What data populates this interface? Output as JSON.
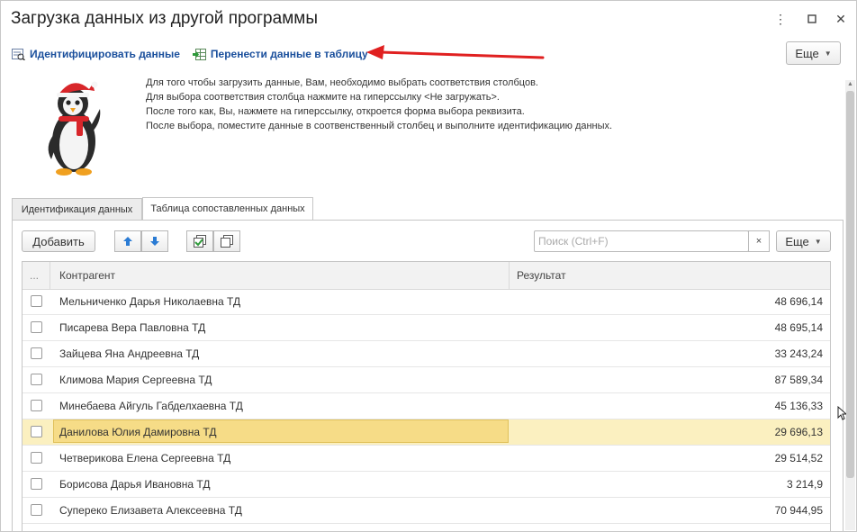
{
  "window": {
    "title": "Загрузка данных из другой программы",
    "more_label": "Еще"
  },
  "commands": {
    "identify_label": "Идентифицировать данные",
    "transfer_label": "Перенести данные в таблицу"
  },
  "help_lines": [
    "Для того чтобы загрузить данные, Вам, необходимо выбрать соответствия столбцов.",
    "Для выбора соответствия столбца нажмите на гиперссылку <Не загружать>.",
    "После того как, Вы, нажмете на гиперссылку, откроется форма выбора реквизита.",
    "После выбора, поместите данные в соотвенственный столбец и выполните идентификацию данных."
  ],
  "tabs": [
    {
      "label": "Идентификация данных",
      "active": false
    },
    {
      "label": "Таблица сопоставленных данных",
      "active": true
    }
  ],
  "toolbar": {
    "add_label": "Добавить",
    "search_placeholder": "Поиск (Ctrl+F)",
    "clear_label": "×",
    "more_label": "Еще"
  },
  "table": {
    "columns": [
      "...",
      "Контрагент",
      "Результат"
    ],
    "rows": [
      {
        "name": "Мельниченко Дарья Николаевна ТД",
        "result": "48 696,14",
        "checked": false
      },
      {
        "name": "Писарева Вера Павловна ТД",
        "result": "48 695,14",
        "checked": false
      },
      {
        "name": "Зайцева Яна Андреевна ТД",
        "result": "33 243,24",
        "checked": false
      },
      {
        "name": "Климова Мария Сергеевна ТД",
        "result": "87 589,34",
        "checked": false
      },
      {
        "name": "Минебаева Айгуль Габделхаевна ТД",
        "result": "45 136,33",
        "checked": false
      },
      {
        "name": "Данилова Юлия Дамировна ТД",
        "result": "29 696,13",
        "checked": false,
        "selected": true
      },
      {
        "name": "Четверикова Елена Сергеевна ТД",
        "result": "29 514,52",
        "checked": false
      },
      {
        "name": "Борисова Дарья Ивановна ТД",
        "result": "3 214,9",
        "checked": false
      },
      {
        "name": "Суперeко Елизавета Алексеевна ТД",
        "result": "70 944,95",
        "checked": false
      }
    ]
  },
  "colors": {
    "link": "#1a4f9c",
    "selected_row": "#fbf0c0",
    "selected_cell": "#f6dc87",
    "annotation_arrow": "#e02020"
  }
}
